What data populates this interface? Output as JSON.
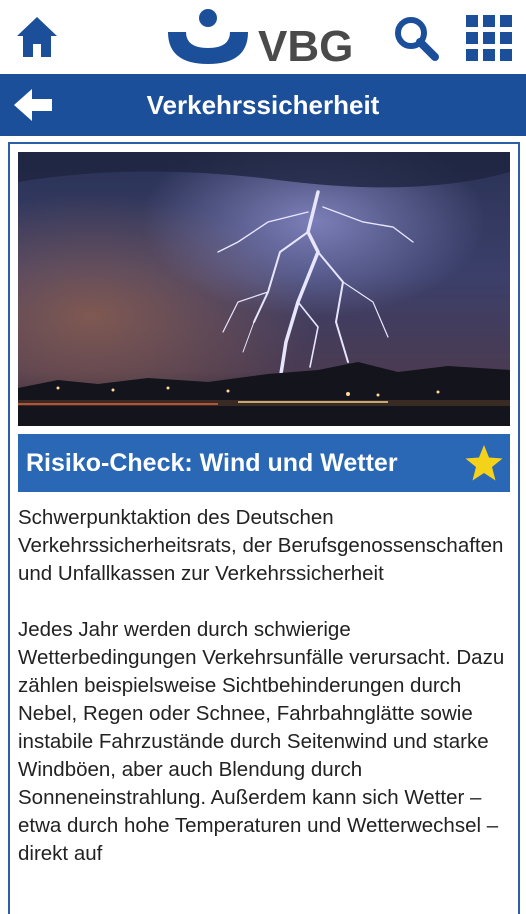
{
  "header": {
    "logo_text": "VBG",
    "home_icon": "home-icon",
    "search_icon": "search-icon",
    "apps_icon": "grid-menu-icon"
  },
  "titlebar": {
    "title": "Verkehrssicherheit",
    "back_icon": "back-arrow-icon"
  },
  "article": {
    "image": "lightning-storm-night-photo",
    "title": "Risiko-Check: Wind und Wetter",
    "favorite_icon": "star-icon",
    "favorite_color": "#f5d21a",
    "paragraphs": [
      "Schwerpunktaktion des Deutschen Verkehrssicherheitsrats, der Berufsgenossenschaften und Unfallkassen zur Verkehrssicherheit",
      "Jedes Jahr werden durch schwierige Wetterbedingungen Verkehrsunfälle verursacht. Dazu zählen beispielsweise Sichtbehinderungen durch Nebel, Regen oder Schnee, Fahrbahnglätte sowie instabile Fahrzustände durch Seitenwind und starke Windböen, aber auch Blendung durch Sonneneinstrahlung. Außerdem kann sich Wetter – etwa durch hohe Temperaturen und Wetterwechsel – direkt auf"
    ]
  },
  "colors": {
    "brand_blue": "#1c4f9a",
    "heading_blue": "#2a68b5"
  }
}
